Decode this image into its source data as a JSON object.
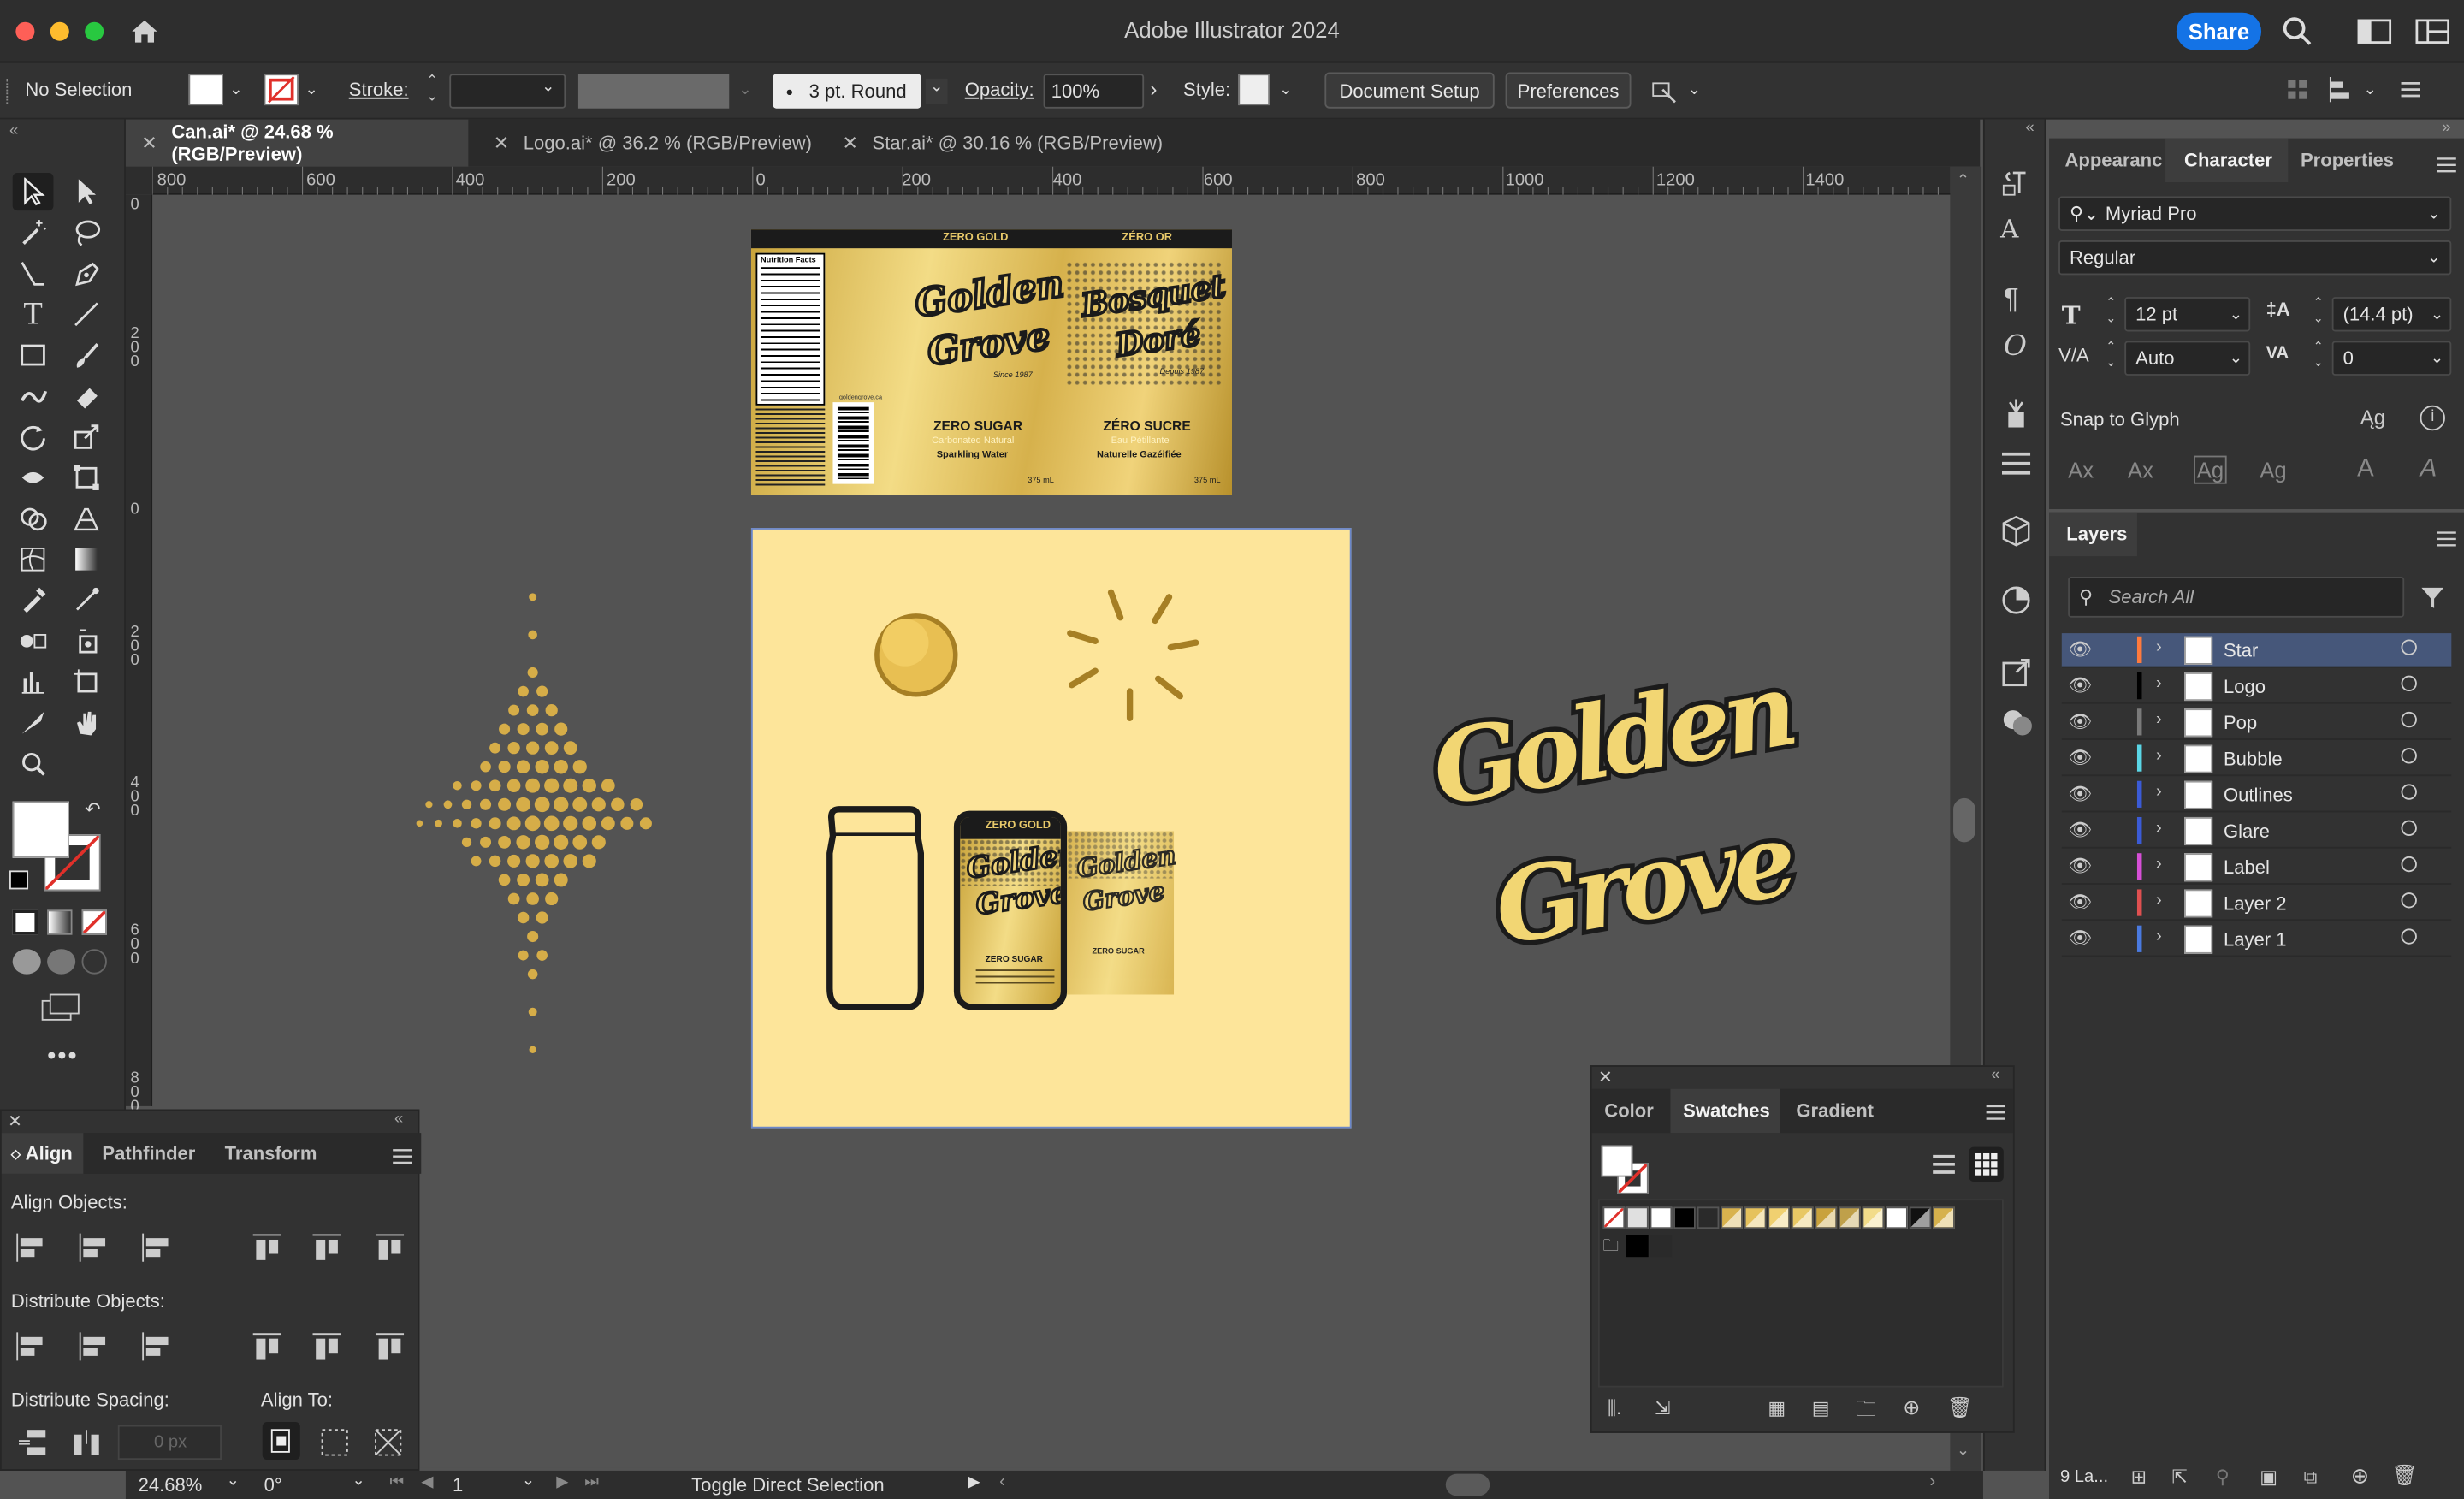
{
  "app": {
    "title": "Adobe Illustrator 2024",
    "share_label": "Share"
  },
  "control_bar": {
    "selection": "No Selection",
    "stroke_label": "Stroke:",
    "brush_value": "3 pt. Round",
    "opacity_label": "Opacity:",
    "opacity_value": "100%",
    "style_label": "Style:",
    "document_setup": "Document Setup",
    "preferences": "Preferences"
  },
  "doc_tabs": [
    {
      "label": "Can.ai* @ 24.68 % (RGB/Preview)",
      "active": true
    },
    {
      "label": "Logo.ai* @ 36.2 % (RGB/Preview)",
      "active": false
    },
    {
      "label": "Star.ai* @ 30.16 % (RGB/Preview)",
      "active": false
    }
  ],
  "ruler": {
    "h_ticks": [
      "800",
      "600",
      "400",
      "200",
      "0",
      "200",
      "400",
      "600",
      "800",
      "1000",
      "1200",
      "1400"
    ],
    "v_ticks": [
      "0",
      "200",
      "0",
      "200",
      "400",
      "600",
      "800"
    ]
  },
  "artwork": {
    "label_top_left": "ZERO GOLD",
    "label_top_right": "ZÉRO OR",
    "nutrition_title": "Nutrition Facts",
    "brand_left_1": "Golden",
    "brand_left_2": "Grove",
    "since": "Since 1987",
    "brand_right_1": "Bosquet",
    "brand_right_2": "Doré",
    "depuis": "Depuis 1987",
    "zero_sugar": "ZERO SUGAR",
    "carbonated": "Carbonated Natural",
    "sparkling": "Sparkling Water",
    "zero_sucre": "ZÉRO SUCRE",
    "eau": "Eau Pétillante",
    "gazeifiee": "Naturelle Gazéifiée",
    "volume_1": "375 mL",
    "volume_2": "375 mL",
    "website": "goldengrove.ca",
    "can_zero_gold": "ZERO GOLD",
    "can_brand_1": "Golden",
    "can_brand_2": "Grove",
    "can_zero_sugar": "ZERO SUGAR",
    "logo_line1": "Golden",
    "logo_line2": "Grove"
  },
  "character_panel": {
    "tabs": [
      "Appearance",
      "Character",
      "Properties"
    ],
    "font_family": "Myriad Pro",
    "font_style": "Regular",
    "font_size": "12 pt",
    "leading": "(14.4 pt)",
    "kerning": "Auto",
    "tracking": "0",
    "snap_to_glyph": "Snap to Glyph"
  },
  "layers_panel": {
    "title": "Layers",
    "search_placeholder": "Search All",
    "layers": [
      {
        "name": "Star",
        "color": "#ff7a3d",
        "selected": true
      },
      {
        "name": "Logo",
        "color": "#000000",
        "selected": false
      },
      {
        "name": "Pop",
        "color": "#7a7a7a",
        "selected": false
      },
      {
        "name": "Bubble",
        "color": "#5ad6e6",
        "selected": false
      },
      {
        "name": "Outlines",
        "color": "#3b5bd6",
        "selected": false
      },
      {
        "name": "Glare",
        "color": "#3b5bd6",
        "selected": false
      },
      {
        "name": "Label",
        "color": "#d64fd6",
        "selected": false
      },
      {
        "name": "Layer 2",
        "color": "#e05050",
        "selected": false
      },
      {
        "name": "Layer 1",
        "color": "#4a7ae0",
        "selected": false
      }
    ],
    "count_label": "9 La..."
  },
  "align_panel": {
    "tabs": [
      "Align",
      "Pathfinder",
      "Transform"
    ],
    "align_objects": "Align Objects:",
    "distribute_objects": "Distribute Objects:",
    "distribute_spacing": "Distribute Spacing:",
    "align_to": "Align To:",
    "spacing_value": "0 px"
  },
  "swatch_panel": {
    "tabs": [
      "Color",
      "Swatches",
      "Gradient"
    ]
  },
  "status_bar": {
    "zoom": "24.68%",
    "rotation": "0°",
    "artboard": "1",
    "tool_hint": "Toggle Direct Selection"
  },
  "colors": {
    "accent": "#1473e6",
    "gold": "#d4b04a",
    "artboard_bg": "#fde59a",
    "dot_gold": "#d6ad48"
  }
}
